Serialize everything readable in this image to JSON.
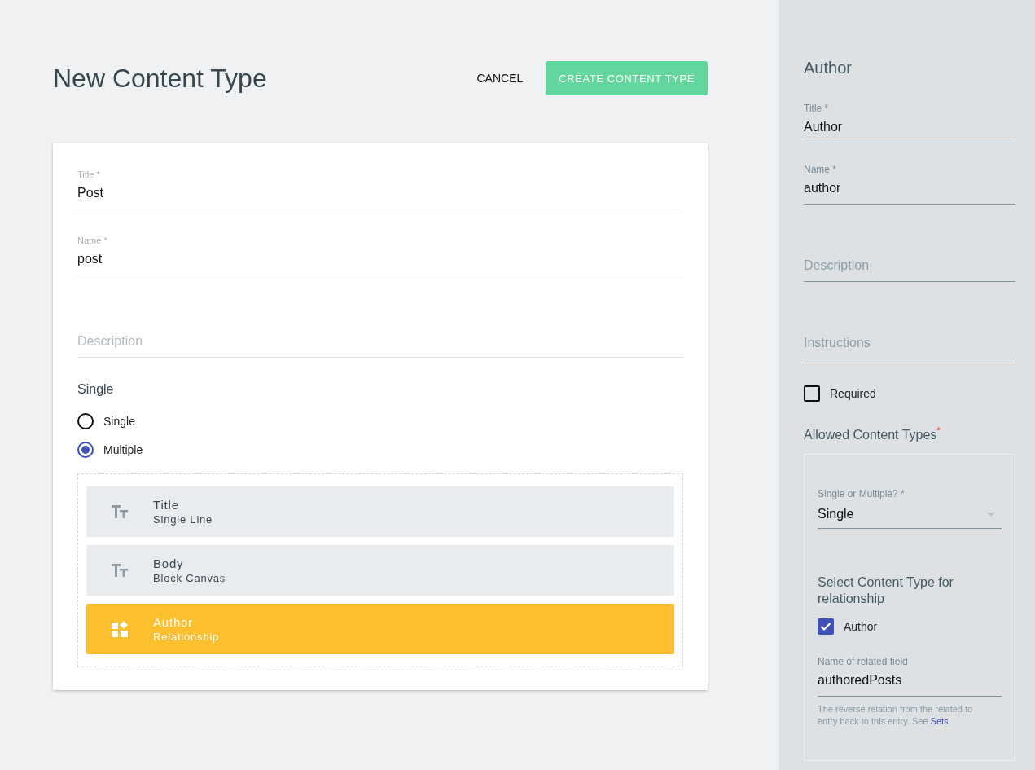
{
  "header": {
    "title": "New Content Type",
    "cancel": "CANCEL",
    "create": "CREATE CONTENT TYPE"
  },
  "form": {
    "fields": [
      {
        "label": "Title *",
        "value": "Post"
      },
      {
        "label": "Name *",
        "value": "post"
      },
      {
        "placeholder": "Description"
      }
    ],
    "mode": {
      "heading": "Single",
      "options": [
        {
          "label": "Single",
          "selected": false
        },
        {
          "label": "Multiple",
          "selected": true
        }
      ]
    },
    "content_fields": [
      {
        "kind": "text",
        "name": "Title",
        "type": "Single Line",
        "selected": false
      },
      {
        "kind": "text",
        "name": "Body",
        "type": "Block Canvas",
        "selected": false
      },
      {
        "kind": "relationship",
        "name": "Author",
        "type": "Relationship",
        "selected": true
      }
    ]
  },
  "sidebar": {
    "title": "Author",
    "fields": [
      {
        "label": "Title *",
        "value": "Author"
      },
      {
        "label": "Name *",
        "value": "author"
      },
      {
        "placeholder": "Description"
      },
      {
        "placeholder": "Instructions"
      }
    ],
    "required": {
      "label": "Required",
      "checked": false
    },
    "allowed": {
      "heading": "Allowed Content Types",
      "mark": "*",
      "select": {
        "label": "Single or Multiple? *",
        "value": "Single"
      },
      "types_heading": "Select Content Type for relationship",
      "types": [
        {
          "label": "Author",
          "checked": true
        }
      ],
      "related": {
        "label": "Name of related field",
        "value": "authoredPosts"
      },
      "help": "The reverse relation from the related to entry back to this entry. See ",
      "help_link": "Sets",
      "help_end": "."
    }
  }
}
